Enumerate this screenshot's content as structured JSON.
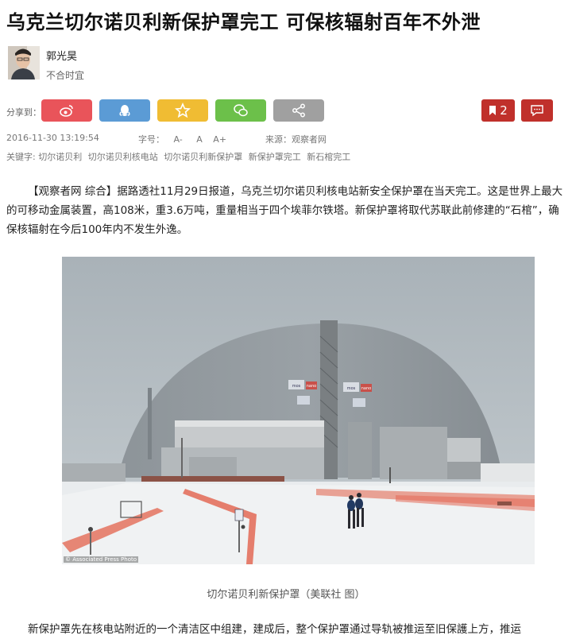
{
  "article": {
    "title": "乌克兰切尔诺贝利新保护罩完工 可保核辐射百年不外泄",
    "author_name": "郭光昊",
    "author_tagline": "不合时宜",
    "share_label": "分享到：",
    "share_buttons": [
      {
        "name": "weibo",
        "color": "#e9545a"
      },
      {
        "name": "qq",
        "color": "#5b9bd5"
      },
      {
        "name": "qzone",
        "color": "#f0bc33"
      },
      {
        "name": "wechat",
        "color": "#6cc04a"
      },
      {
        "name": "more-share",
        "color": "#a0a0a0"
      }
    ],
    "bookmark_count": "2",
    "date": "2016-11-30 13:19:54",
    "font_size_label": "字号：",
    "font_sizes": [
      "A-",
      "A",
      "A+"
    ],
    "source": "来源：观察者网",
    "keywords_label": "关键字:",
    "keywords": [
      "切尔诺贝利",
      "切尔诺贝利核电站",
      "切尔诺贝利新保护罩",
      "新保护罩完工",
      "新石棺完工"
    ],
    "paragraph1": "【观察者网 综合】据路透社11月29日报道，乌克兰切尔诺贝利核电站新安全保护罩在当天完工。这是世界上最大的可移动金属装置，高108米，重3.6万吨，重量相当于四个埃菲尔铁塔。新保护罩将取代苏联此前修建的“石棺”，确保核辐射在今后100年内不发生外逸。",
    "photo_credit": "© Associated Press Photo",
    "photo_signs": [
      "mos",
      "nano",
      "mos",
      "nano"
    ],
    "photo_caption": "切尔诺贝利新保护罩（美联社 图）",
    "paragraph2": "新保护罩先在核电站附近的一个清洁区中组建，建成后，整个保护罩通过导轨被推运至旧保護上方，推运"
  },
  "colors": {
    "accent_red": "#c0302b"
  }
}
